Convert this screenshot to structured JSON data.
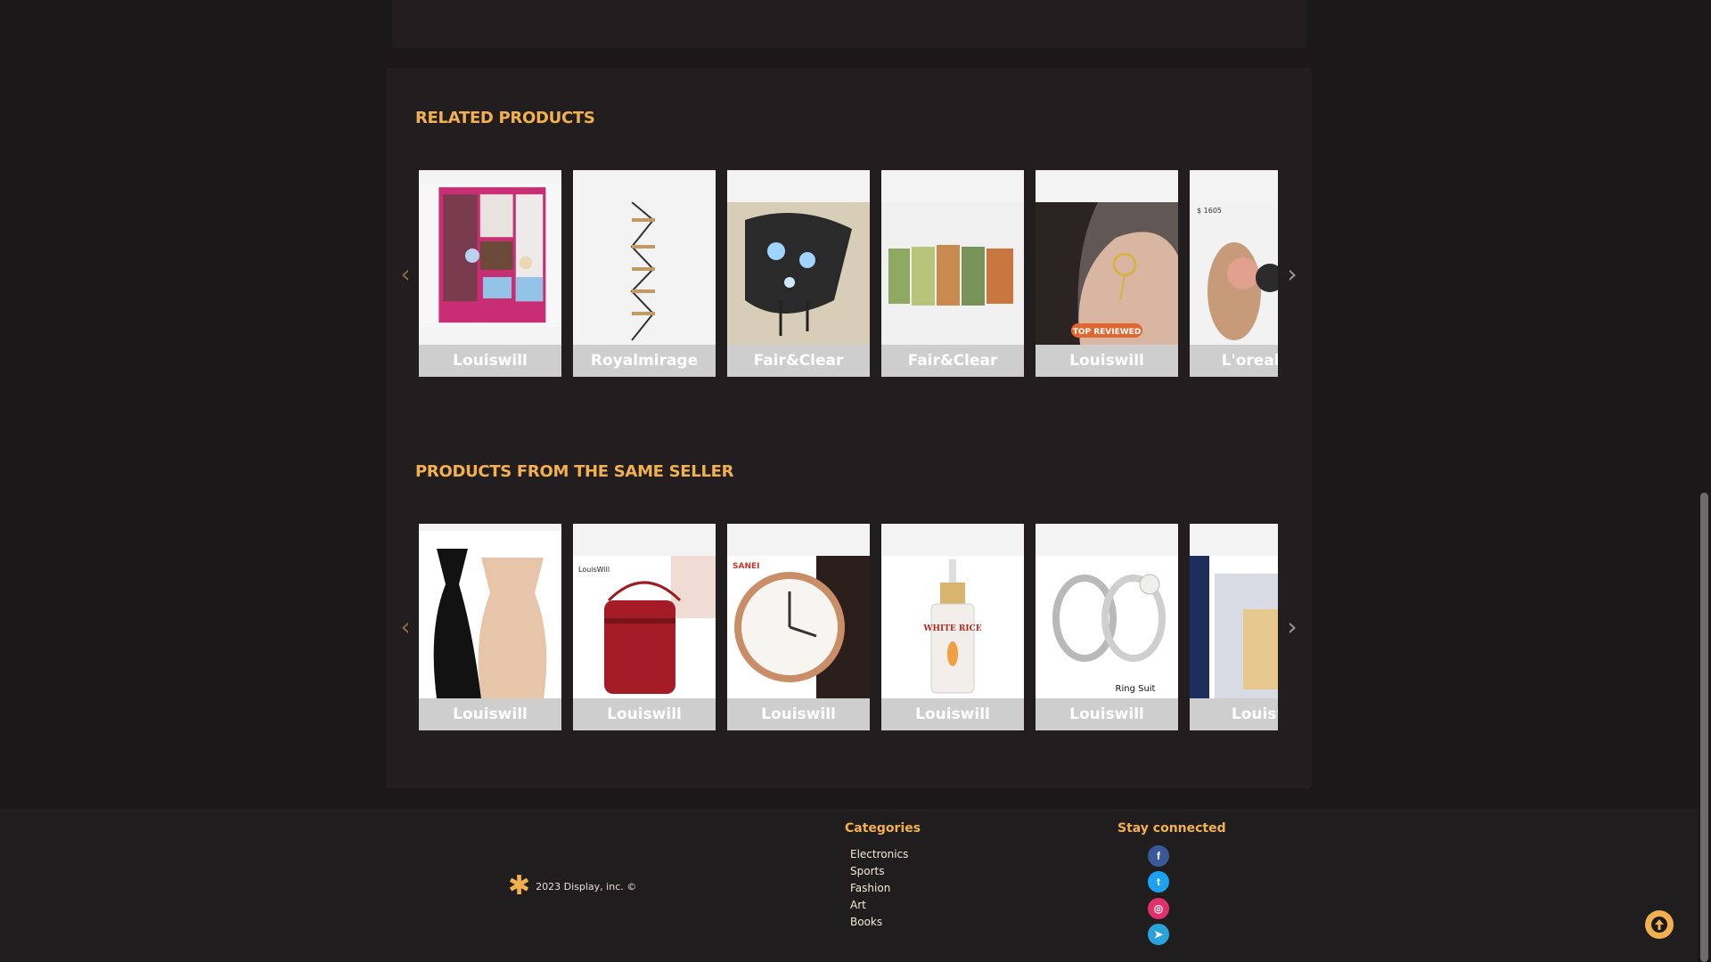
{
  "related": {
    "title": "RELATED PRODUCTS",
    "items": [
      {
        "label": "Louiswill",
        "icon": "wardrobe-image"
      },
      {
        "label": "Royalmirage",
        "icon": "wall-shelf-image"
      },
      {
        "label": "Fair&Clear",
        "icon": "wall-lamp-image"
      },
      {
        "label": "Fair&Clear",
        "icon": "perfume-bottles-image"
      },
      {
        "label": "Louiswill",
        "icon": "ear-cuff-image",
        "badge": "TOP REVIEWED"
      },
      {
        "label": "L'orealpa",
        "icon": "sandals-image",
        "tag": "$ 1605"
      }
    ]
  },
  "seller": {
    "title": "PRODUCTS FROM THE SAME SELLER",
    "items": [
      {
        "label": "Louiswill",
        "icon": "camisole-image"
      },
      {
        "label": "Louiswill",
        "icon": "crossbody-bag-image",
        "brand": "LouisWill"
      },
      {
        "label": "Louiswill",
        "icon": "wristwatch-image",
        "brand": "SANEI"
      },
      {
        "label": "Louiswill",
        "icon": "serum-bottle-image",
        "product_text": "WHITE RICE"
      },
      {
        "label": "Louiswill",
        "icon": "silver-rings-image",
        "caption": "Ring Suit"
      },
      {
        "label": "Louisw",
        "icon": "perfume-box-image"
      }
    ]
  },
  "footer": {
    "copyright": "2023 Display, inc. ©",
    "categories_title": "Categories",
    "categories": [
      "Electronics",
      "Sports",
      "Fashion",
      "Art",
      "Books"
    ],
    "social_title": "Stay connected",
    "social": [
      {
        "name": "facebook-icon",
        "glyph": "f",
        "color": "#3b5998"
      },
      {
        "name": "twitter-icon",
        "glyph": "t",
        "color": "#1da1f2"
      },
      {
        "name": "instagram-icon",
        "glyph": "◎",
        "color": "#e1306c"
      },
      {
        "name": "telegram-icon",
        "glyph": "➤",
        "color": "#2aa3dd"
      }
    ]
  },
  "colors": {
    "accent": "#f2b04e",
    "panel": "#221e1f",
    "background": "#1b1819"
  }
}
